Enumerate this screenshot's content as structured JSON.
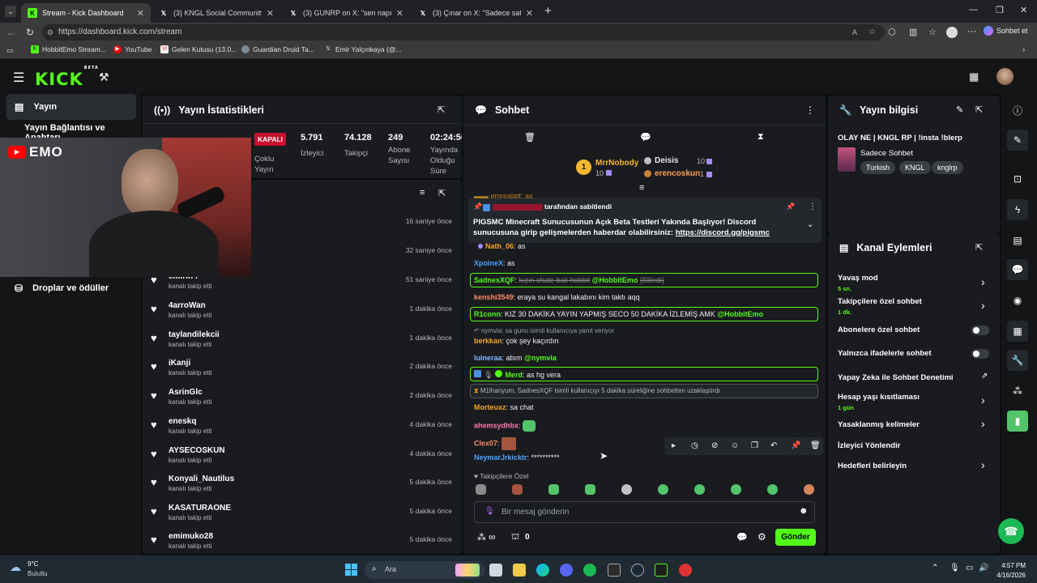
{
  "browser": {
    "tabs": [
      {
        "label": "Stream - Kick Dashboard"
      },
      {
        "label": "(3) KNGL Social Community / X"
      },
      {
        "label": "(3) GUNRP on X: \"sen napıyordun"
      },
      {
        "label": "(3) Çınar on X: \"Sadece satranç atı"
      }
    ],
    "url": "https://dashboard.kick.com/stream",
    "profile_label": "Sohbet et",
    "bookmarks": [
      "HobbitEmo Stream...",
      "YouTube",
      "Gelen Kutusu (13.0...",
      "Guardian Druid Ta...",
      "Emir Yalçınkaya (@..."
    ]
  },
  "app": {
    "logo": "KICK",
    "logo_badge": "BETA"
  },
  "sidebar": {
    "items": [
      {
        "label": "Yayın"
      },
      {
        "label": "Yayın Bağlantısı ve Anahtarı"
      },
      {
        "label": "Droplar ve ödüller"
      }
    ]
  },
  "webcam": {
    "channel_label": "EMO"
  },
  "stats_panel": {
    "title": "Yayın İstatistikleri",
    "status": "KAPALI",
    "status_caption": "Çoklu Yayın",
    "stats": [
      {
        "value": "5.791",
        "label": "İzleyici"
      },
      {
        "value": "74.128",
        "label": "Takipçi"
      },
      {
        "value": "249",
        "label": "Abone Sayısı"
      },
      {
        "value": "02:24:56",
        "label": "Yayında Olduğu Süre"
      }
    ]
  },
  "activity": {
    "rows": [
      {
        "name": "",
        "sub": "",
        "time": "16 saniye önce"
      },
      {
        "name": "",
        "sub": "",
        "time": "32 saniye önce"
      },
      {
        "name": "emirk77",
        "sub": "kanalı takip etti",
        "time": "51 saniye önce"
      },
      {
        "name": "4arroWan",
        "sub": "kanalı takip etti",
        "time": "1 dakika önce"
      },
      {
        "name": "taylandilekcii",
        "sub": "kanalı takip etti",
        "time": "1 dakika önce"
      },
      {
        "name": "iKanji",
        "sub": "kanalı takip etti",
        "time": "2 dakika önce"
      },
      {
        "name": "AsrinGlc",
        "sub": "kanalı takip etti",
        "time": "2 dakika önce"
      },
      {
        "name": "eneskq",
        "sub": "kanalı takip etti",
        "time": "4 dakika önce"
      },
      {
        "name": "AYSECOSKUN",
        "sub": "kanalı takip etti",
        "time": "4 dakika önce"
      },
      {
        "name": "Konyali_Nautilus",
        "sub": "kanalı takip etti",
        "time": "5 dakika önce"
      },
      {
        "name": "KASATURAONE",
        "sub": "kanalı takip etti",
        "time": "5 dakika önce"
      },
      {
        "name": "emimuko28",
        "sub": "kanalı takip etti",
        "time": "5 dakika önce"
      }
    ]
  },
  "chat": {
    "title": "Sohbet",
    "leaderboard": [
      {
        "rank": "1",
        "name": "MrrNobody",
        "count": "10"
      },
      {
        "name": "Deisis",
        "count": "10"
      },
      {
        "name": "erencoskun",
        "count": "1"
      }
    ],
    "pinned": {
      "pinned_by": "tarafından sabitlendi",
      "text": "PIGSMC Minecraft Sunucusunun Açık Beta Testleri Yakında Başlıyor! Discord sunucusuna girip gelişmelerden haberdar olabilirsiniz:",
      "link": "https://discord.gg/pigsmc"
    },
    "messages": [
      {
        "user": "Nath_06",
        "text": "as",
        "color": "#f5a623"
      },
      {
        "user": "XpoineX",
        "text": "as",
        "color": "#4aa3ff"
      },
      {
        "user": "SadnesXQF",
        "text": "kızın chate bak hobbit",
        "mention": "@HobbitEmo",
        "note": "(Silindi)",
        "color": "#53fc18"
      },
      {
        "user": "kenshi3549",
        "text": "eraya su kangal lakabını kim taktı aqq",
        "color": "#ff8a65"
      },
      {
        "user": "R1conn",
        "text": "KIZ 30 DAKİKA YAYIN YAPMIŞ SECO 50 DAKİKA İZLEMİŞ AMK",
        "mention": "@HobbitEmo",
        "color": "#53fc18"
      },
      {
        "reply": "nymvia: sa guno isimli kullanıcıya yanıt veriyor"
      },
      {
        "user": "berkkan",
        "text": "çok şey kaçırdın",
        "color": "#f5a623"
      },
      {
        "user": "luineraa",
        "text": "abım",
        "mention": "@nymvia",
        "color": "#7fb6ff"
      },
      {
        "user": "Merd",
        "text": "as hg vera",
        "color": "#53fc18"
      },
      {
        "timeout": "M1lhanyum, SadnesXQF isimli kullanıcıyı 5 dakika süreliğine sohbetten uzaklaştırdı"
      },
      {
        "user": "Morteuxz",
        "text": "sa chat",
        "color": "#f5a623"
      },
      {
        "user": "ahemsydhbx",
        "text": "",
        "color": "#ff7aa8"
      },
      {
        "user": "Clex07",
        "text": "",
        "color": "#ff8a65"
      },
      {
        "user": "NeymarJrkicktr",
        "text": "**********",
        "color": "#4aa3ff"
      }
    ],
    "followers_only_label": "Takipçilere Özel",
    "input_placeholder": "Bir mesaj gönderin",
    "points": "0",
    "send_label": "Gönder"
  },
  "stream_info": {
    "title": "Yayın bilgisi",
    "stream_title": "OLAY NE | KNGL RP | !insta !blerp",
    "category": "Sadece Sohbet",
    "tags": [
      "Turkish",
      "KNGL",
      "knglrp"
    ]
  },
  "channel_actions": {
    "title": "Kanal Eylemleri",
    "items": [
      {
        "label": "Yavaş mod",
        "value": "5 sn."
      },
      {
        "label": "Takipçilere özel sohbet",
        "value": "1 dk."
      },
      {
        "label": "Abonelere özel sohbet"
      },
      {
        "label": "Yalnızca ifadelerle sohbet"
      },
      {
        "label": "Yapay Zeka ile Sohbet Denetimi"
      },
      {
        "label": "Hesap yaşı kısıtlaması",
        "value": "1 gün"
      },
      {
        "label": "Yasaklanmış kelimeler"
      },
      {
        "label": "İzleyici Yönlendir"
      },
      {
        "label": "Hedefleri belirleyin"
      }
    ]
  },
  "taskbar": {
    "weather_temp": "9°C",
    "weather_desc": "Bulutlu",
    "search_placeholder": "Ara",
    "time": "4:57 PM",
    "date": "4/16/2026"
  }
}
